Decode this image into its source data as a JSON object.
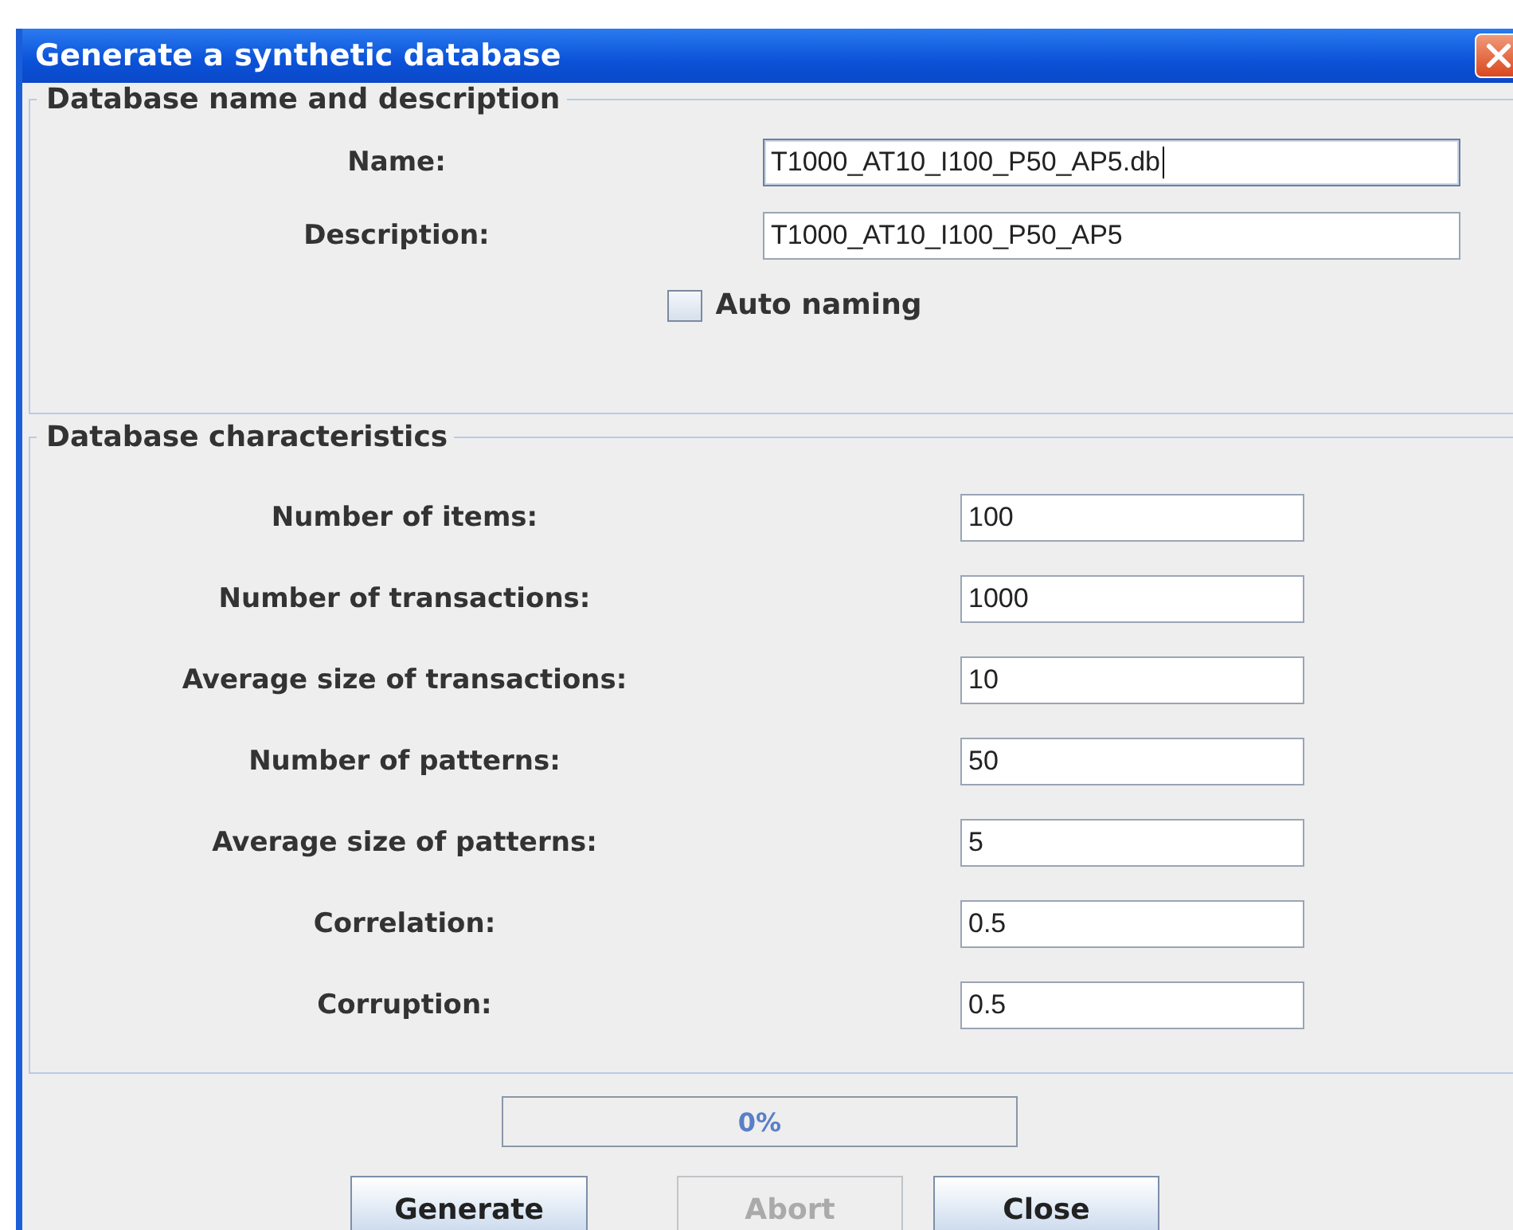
{
  "window": {
    "title": "Generate a synthetic database"
  },
  "name_section": {
    "legend": "Database name and description",
    "fields": [
      {
        "label": "Name:",
        "value": "T1000_AT10_I100_P50_AP5.db",
        "focused": true
      },
      {
        "label": "Description:",
        "value": "T1000_AT10_I100_P50_AP5",
        "focused": false
      }
    ],
    "auto_naming": {
      "label": "Auto naming",
      "checked": false
    }
  },
  "characteristics_section": {
    "legend": "Database characteristics",
    "fields": [
      {
        "label": "Number of items:",
        "value": "100"
      },
      {
        "label": "Number of transactions:",
        "value": "1000"
      },
      {
        "label": "Average size of transactions:",
        "value": "10"
      },
      {
        "label": "Number of patterns:",
        "value": "50"
      },
      {
        "label": "Average size of patterns:",
        "value": "5"
      },
      {
        "label": "Correlation:",
        "value": "0.5"
      },
      {
        "label": "Corruption:",
        "value": "0.5"
      }
    ]
  },
  "progress": {
    "level": 0,
    "text": "0%"
  },
  "buttons": [
    {
      "label": "Generate",
      "disabled": false
    },
    {
      "label": "Abort",
      "disabled": true
    },
    {
      "label": "Close",
      "disabled": false
    }
  ]
}
